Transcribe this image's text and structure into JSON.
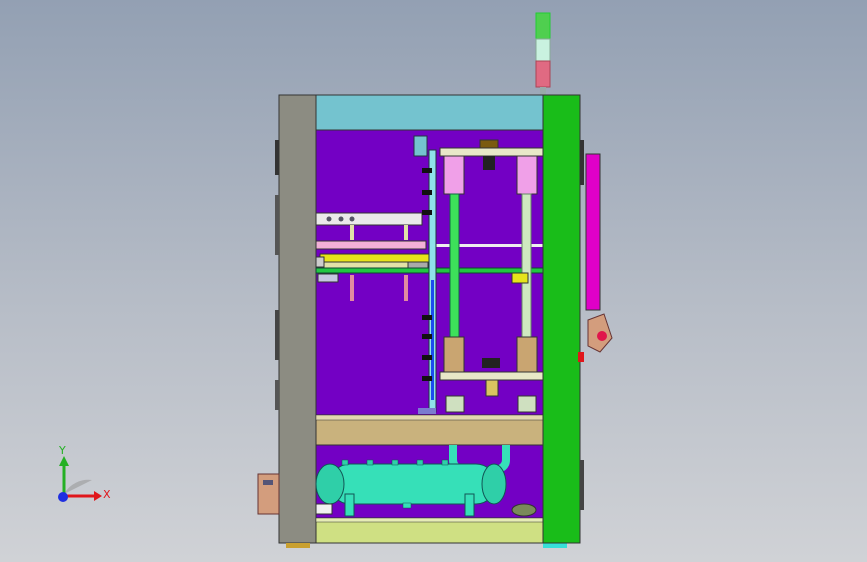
{
  "viewport": {
    "background_top": "#93a0b3",
    "background_bottom": "#d0d2d6"
  },
  "triad": {
    "x_label": "X",
    "y_label": "Y",
    "x_color": "#e0161b",
    "y_color": "#24b024",
    "z_color": "#1f2fe0"
  },
  "model": {
    "frame_color": "#8c8c82",
    "side_panel_color": "#19bd19",
    "interior_color": "#7300c4",
    "top_panel_color": "#74c3cf",
    "base_color": "#cfe083",
    "tank_color": "#36e0b8",
    "tower_light_colors": [
      "#4fcf4f",
      "#c9f2e0",
      "#e06a82"
    ],
    "pink_column_color": "#f0a0e8",
    "bronze_color": "#c9a571",
    "magenta_panel_color": "#e000c8"
  }
}
